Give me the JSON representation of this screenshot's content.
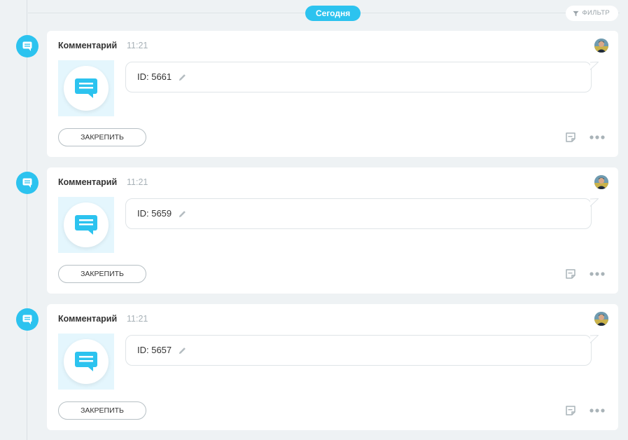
{
  "timeline": {
    "date_label": "Сегодня",
    "filter_label": "ФИЛЬТР"
  },
  "entries": [
    {
      "title": "Комментарий",
      "time": "11:21",
      "text": "ID: 5661",
      "pin_label": "ЗАКРЕПИТЬ"
    },
    {
      "title": "Комментарий",
      "time": "11:21",
      "text": "ID: 5659",
      "pin_label": "ЗАКРЕПИТЬ"
    },
    {
      "title": "Комментарий",
      "time": "11:21",
      "text": "ID: 5657",
      "pin_label": "ЗАКРЕПИТЬ"
    }
  ],
  "icons": {
    "entry": "comment-icon",
    "thumbnail": "comment-icon",
    "edit": "pencil-icon",
    "note": "note-icon",
    "more": "more-dots-icon",
    "filter": "filter-icon"
  },
  "colors": {
    "accent": "#2cc3ef",
    "background": "#eef2f4",
    "card": "#ffffff",
    "muted_text": "#a7b1b7"
  }
}
